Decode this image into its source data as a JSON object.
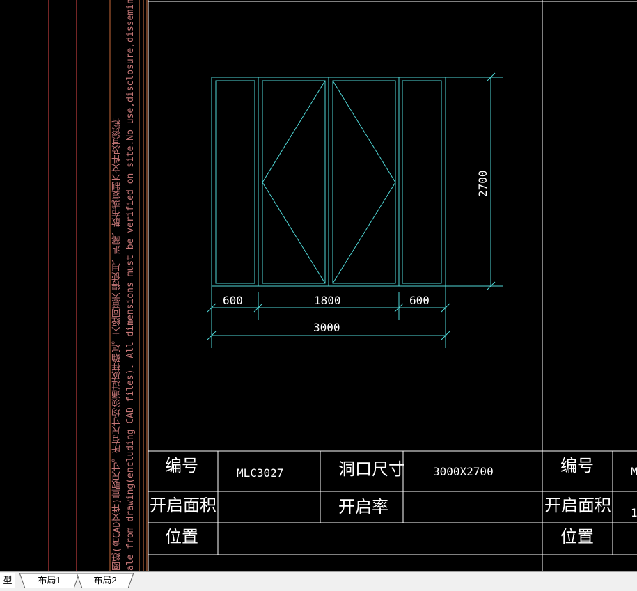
{
  "side_notes": {
    "cn": "图纸(含CAD文件)量取尺寸。所有尺寸均须通过放样确定。未经同意不得使用、泄露、散布或复制本文件及其资料",
    "en": "ale from drawing(encluding CAD files). All dimensions must be verified on site.No use,disclosure,dissemination or duplication of an"
  },
  "dimensions": {
    "height": "2700",
    "left": "600",
    "middle": "1800",
    "right": "600",
    "total": "3000"
  },
  "table": {
    "r1_label1": "编号",
    "r1_value1": "MLC3027",
    "r1_label2": "洞口尺寸",
    "r1_value2": "3000X2700",
    "r1_label3": "编号",
    "r1_value3": "M",
    "r2_label1": "开启面积",
    "r2_label2": "开启率",
    "r2_label3": "开启面积",
    "r2_value3": "1",
    "r3_label1": "位置",
    "r3_label3": "位置"
  },
  "tabs": {
    "model_partial": "型",
    "layout1": "布局1",
    "layout2": "布局2"
  },
  "colors": {
    "window_line": "#4fd6d6",
    "border_white": "#ffffff",
    "side_red": "#c87878",
    "cad_background": "#000000"
  }
}
